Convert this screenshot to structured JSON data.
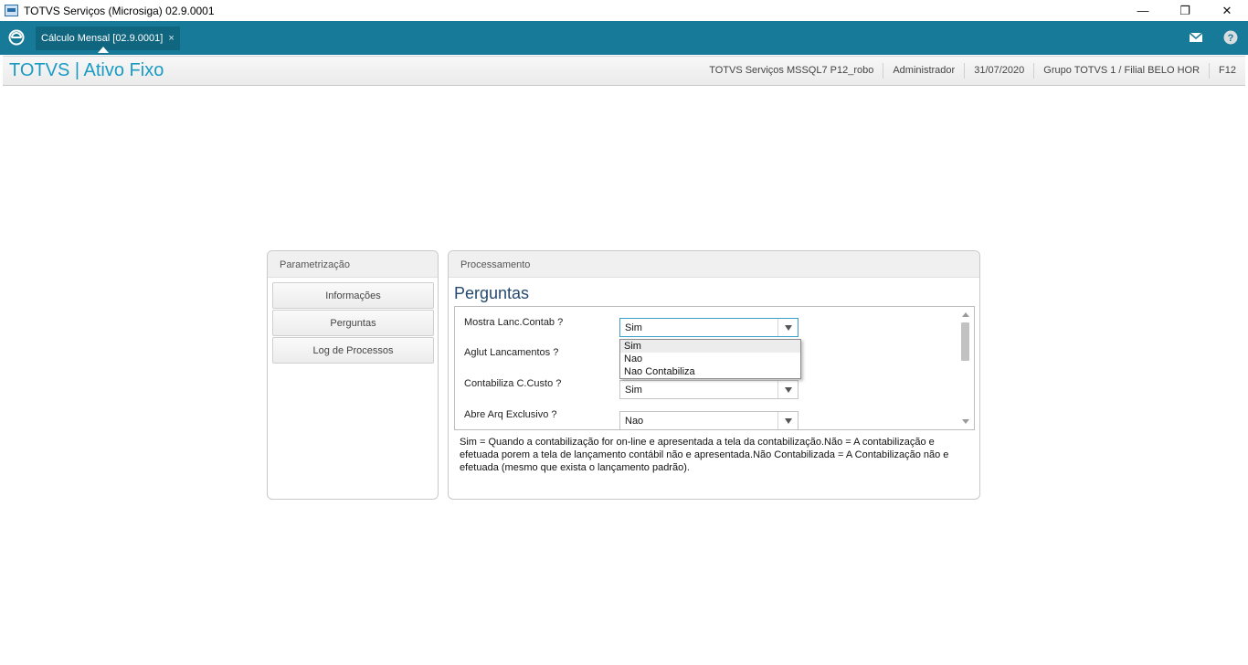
{
  "window": {
    "title": "TOTVS Serviços (Microsiga) 02.9.0001",
    "controls": {
      "minimize": "—",
      "restore": "❐",
      "close": "✕"
    }
  },
  "tabbar": {
    "active_tab": "Cálculo Mensal [02.9.0001]",
    "tab_close": "×",
    "color": "#177a98"
  },
  "header": {
    "module_title": "TOTVS | Ativo Fixo",
    "environment": "TOTVS Serviços MSSQL7 P12_robo",
    "user": "Administrador",
    "date": "31/07/2020",
    "company": "Grupo TOTVS 1 / Filial BELO HOR",
    "shortcut": "F12"
  },
  "left_panel": {
    "title": "Parametrização",
    "buttons": [
      "Informações",
      "Perguntas",
      "Log de Processos"
    ]
  },
  "right_panel": {
    "title": "Processamento",
    "section_title": "Perguntas",
    "questions": [
      {
        "label": "Mostra Lanc.Contab ?",
        "value": "Sim"
      },
      {
        "label": "Aglut Lancamentos ?",
        "value": ""
      },
      {
        "label": "Contabiliza C.Custo ?",
        "value": "Sim"
      },
      {
        "label": "Abre Arq Exclusivo ?",
        "value": "Nao"
      }
    ],
    "dropdown_options": [
      "Sim",
      "Nao",
      "Nao Contabiliza"
    ],
    "help_text": "Sim = Quando a contabilização for on-line e apresentada a tela da contabilização.Não = A contabilização e efetuada porem a tela de lançamento contábil não e apresentada.Não Contabilizada = A Contabilização não e efetuada (mesmo que exista o lançamento padrão)."
  }
}
